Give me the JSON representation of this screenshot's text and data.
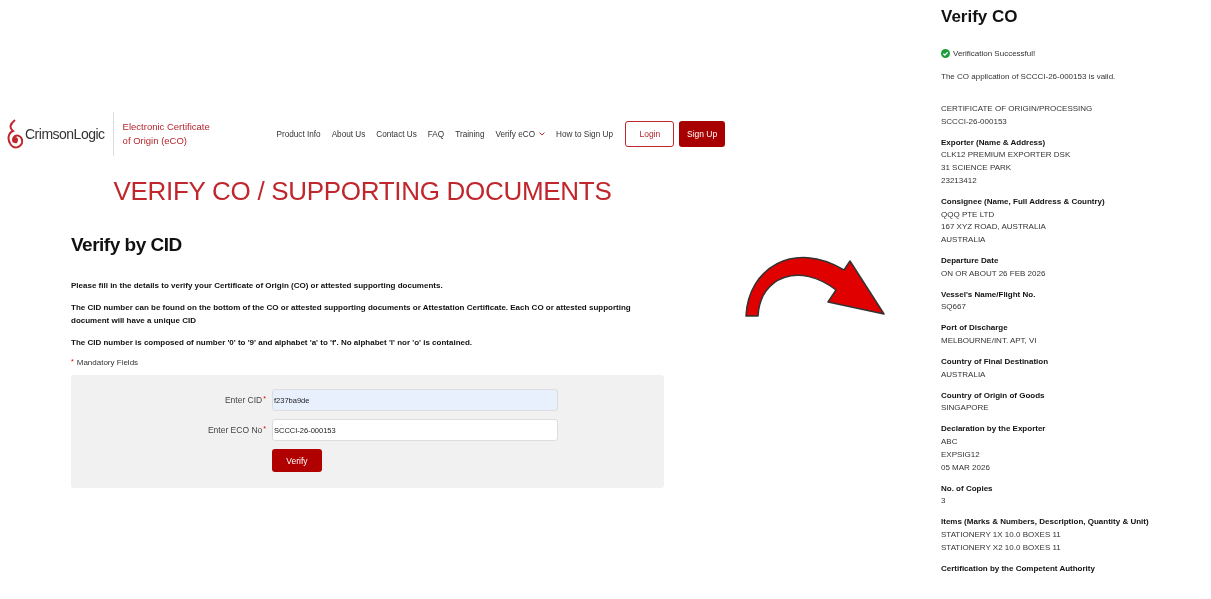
{
  "header": {
    "brand": "CrimsonLogic",
    "product_title": "Electronic Certificate of Origin (eCO)",
    "nav": [
      {
        "label": "Product Info",
        "kind": "link"
      },
      {
        "label": "About Us",
        "kind": "link"
      },
      {
        "label": "Contact Us",
        "kind": "link"
      },
      {
        "label": "FAQ",
        "kind": "link"
      },
      {
        "label": "Training",
        "kind": "link"
      },
      {
        "label": "Verify eCO",
        "kind": "dropdown"
      },
      {
        "label": "How to Sign Up",
        "kind": "link"
      }
    ],
    "buttons": [
      {
        "label": "Login",
        "kind": "outline"
      },
      {
        "label": "Sign Up",
        "kind": "filled"
      }
    ]
  },
  "page_title": "VERIFY CO / SUPPORTING DOCUMENTS",
  "section_title": "Verify by CID",
  "instructions": [
    "Please fill in the details to verify your Certificate of Origin (CO) or attested supporting documents.",
    "The CID number can be found on the bottom of the CO or attested supporting documents or Attestation Certificate. Each CO or attested supporting document will have a unique CID",
    "The CID number is composed of number '0' to '9' and alphabet 'a' to 'f'. No alphabet 'l' nor 'o' is contained."
  ],
  "required_mark": "*",
  "mandatory_note": "Mandatory Fields",
  "form": {
    "fields": [
      {
        "label": "Enter CID",
        "value": "f237ba9de",
        "required": true,
        "autofilled": true
      },
      {
        "label": "Enter ECO No",
        "value": "SCCCI-26-000153",
        "required": true,
        "autofilled": false
      }
    ],
    "submit": "Verify"
  },
  "result": {
    "title": "Verify CO",
    "status": {
      "text": "Verification Successful!",
      "success": true
    },
    "message": "The CO application of SCCCI-26-000153 is valid.",
    "sections": [
      {
        "lines": [
          "CERTIFICATE OF ORIGIN/PROCESSING",
          "SCCCI-26-000153"
        ]
      },
      {
        "heading": "Exporter (Name & Address)",
        "lines": [
          "CLK12 PREMIUM EXPORTER DSK",
          "31 SCIENCE PARK",
          "23213412"
        ]
      },
      {
        "heading": "Consignee (Name, Full Address & Country)",
        "lines": [
          "QQQ PTE LTD",
          "167 XYZ ROAD, AUSTRALIA",
          "AUSTRALIA"
        ]
      },
      {
        "heading": "Departure Date",
        "lines": [
          "ON OR ABOUT 26 FEB 2026"
        ]
      },
      {
        "heading": "Vessel's Name/Flight No.",
        "lines": [
          "SQ667"
        ]
      },
      {
        "heading": "Port of Discharge",
        "lines": [
          "MELBOURNE/INT. APT, VI"
        ]
      },
      {
        "heading": "Country of Final Destination",
        "lines": [
          "AUSTRALIA"
        ]
      },
      {
        "heading": "Country of Origin of Goods",
        "lines": [
          "SINGAPORE"
        ]
      },
      {
        "heading": "Declaration by the Exporter",
        "lines": [
          "ABC",
          "EXPSIG12",
          "05 MAR 2026"
        ]
      },
      {
        "heading": "No. of Copies",
        "lines": [
          "3"
        ]
      },
      {
        "heading": "Items (Marks & Numbers, Description, Quantity & Unit)",
        "lines": [
          "STATIONERY 1X 10.0 BOXES 11",
          "STATIONERY X2 10.0 BOXES 11"
        ]
      },
      {
        "heading": "Certification by the Competent Authority"
      }
    ]
  }
}
